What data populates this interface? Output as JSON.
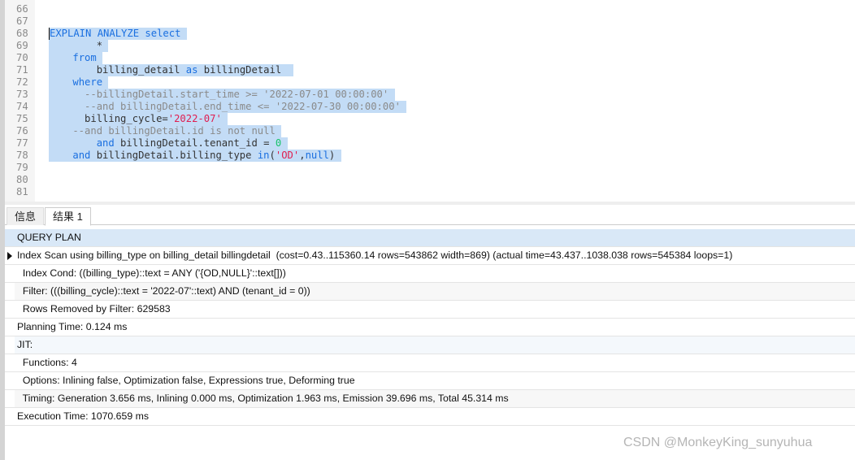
{
  "editor": {
    "lines": [
      {
        "n": "66"
      },
      {
        "n": "67"
      },
      {
        "n": "68",
        "parts": [
          {
            "t": "EXPLAIN ANALYZE select ",
            "c": "kw"
          }
        ]
      },
      {
        "n": "69",
        "parts": [
          {
            "t": "        * ",
            "c": "id"
          }
        ]
      },
      {
        "n": "70",
        "parts": [
          {
            "t": "    ",
            "c": "id"
          },
          {
            "t": "from ",
            "c": "kw"
          }
        ]
      },
      {
        "n": "71",
        "parts": [
          {
            "t": "        billing_detail ",
            "c": "id"
          },
          {
            "t": "as",
            "c": "kw"
          },
          {
            "t": " billingDetail  ",
            "c": "id"
          }
        ]
      },
      {
        "n": "72",
        "parts": [
          {
            "t": "    ",
            "c": "id"
          },
          {
            "t": "where ",
            "c": "kw"
          }
        ]
      },
      {
        "n": "73",
        "parts": [
          {
            "t": "      --billingDetail.start_time >= '2022-07-01 00:00:00' ",
            "c": "cm"
          }
        ]
      },
      {
        "n": "74",
        "parts": [
          {
            "t": "      --and billingDetail.end_time <= '2022-07-30 00:00:00' ",
            "c": "cm"
          }
        ]
      },
      {
        "n": "75",
        "parts": [
          {
            "t": "      billing_cycle=",
            "c": "id"
          },
          {
            "t": "'2022-07'",
            "c": "st"
          },
          {
            "t": " ",
            "c": "id"
          }
        ]
      },
      {
        "n": "76",
        "parts": [
          {
            "t": "    --and billingDetail.id is not null ",
            "c": "cm"
          }
        ]
      },
      {
        "n": "77",
        "parts": [
          {
            "t": "        ",
            "c": "id"
          },
          {
            "t": "and",
            "c": "kw"
          },
          {
            "t": " billingDetail.tenant_id = ",
            "c": "id"
          },
          {
            "t": "0",
            "c": "nm"
          },
          {
            "t": " ",
            "c": "id"
          }
        ]
      },
      {
        "n": "78",
        "parts": [
          {
            "t": "    ",
            "c": "id"
          },
          {
            "t": "and",
            "c": "kw"
          },
          {
            "t": " billingDetail.billing_type ",
            "c": "id"
          },
          {
            "t": "in",
            "c": "kw"
          },
          {
            "t": "(",
            "c": "id"
          },
          {
            "t": "'OD'",
            "c": "st"
          },
          {
            "t": ",",
            "c": "id"
          },
          {
            "t": "null",
            "c": "kw"
          },
          {
            "t": ") ",
            "c": "id"
          }
        ]
      },
      {
        "n": "79"
      },
      {
        "n": "80"
      },
      {
        "n": "81"
      }
    ]
  },
  "tabs": {
    "info": "信息",
    "result": "结果 1"
  },
  "grid": {
    "header": "QUERY PLAN",
    "rows": [
      {
        "text": "Index Scan using billing_type on billing_detail billingdetail  (cost=0.43..115360.14 rows=543862 width=869) (actual time=43.437..1038.038 rows=545384 loops=1)",
        "style": "",
        "current": true
      },
      {
        "text": "  Index Cond: ((billing_type)::text = ANY ('{OD,NULL}'::text[]))",
        "style": ""
      },
      {
        "text": "  Filter: (((billing_cycle)::text = '2022-07'::text) AND (tenant_id = 0))",
        "style": "alt"
      },
      {
        "text": "  Rows Removed by Filter: 629583",
        "style": ""
      },
      {
        "text": "Planning Time: 0.124 ms",
        "style": ""
      },
      {
        "text": "JIT:",
        "style": "blue"
      },
      {
        "text": "  Functions: 4",
        "style": ""
      },
      {
        "text": "  Options: Inlining false, Optimization false, Expressions true, Deforming true",
        "style": ""
      },
      {
        "text": "  Timing: Generation 3.656 ms, Inlining 0.000 ms, Optimization 1.963 ms, Emission 39.696 ms, Total 45.314 ms",
        "style": "alt"
      },
      {
        "text": "Execution Time: 1070.659 ms",
        "style": ""
      }
    ]
  },
  "watermark": "CSDN @MonkeyKing_sunyuhua"
}
